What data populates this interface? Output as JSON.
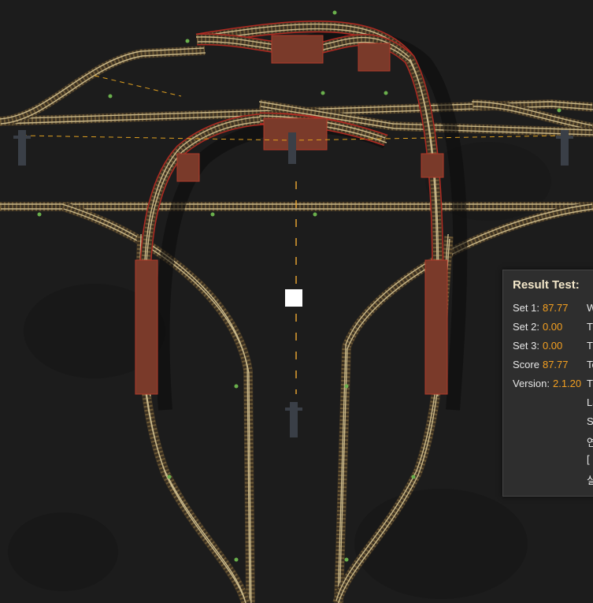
{
  "panel": {
    "title": "Result Test:",
    "title_trail": "'",
    "rows": [
      {
        "label": "Set 1:",
        "value": "87.77"
      },
      {
        "label": "Set 2:",
        "value": "0.00"
      },
      {
        "label": "Set 3:",
        "value": "0.00"
      },
      {
        "label": "Score",
        "value": "87.77"
      },
      {
        "label": "Version:",
        "value": "2.1.20"
      }
    ],
    "side_column": [
      "W",
      "Ti",
      "T",
      "Tc",
      "Tr",
      "La",
      "S",
      "연",
      "[",
      "실"
    ]
  },
  "colors": {
    "background": "#1c1c1c",
    "rail": "#c9b88a",
    "elevated_edge": "#b02a22",
    "value_orange": "#f5a020",
    "panel_bg": "#2e2e2e"
  },
  "icons": [
    "power-pole-icon",
    "rail-signal-icon",
    "cursor-square"
  ]
}
